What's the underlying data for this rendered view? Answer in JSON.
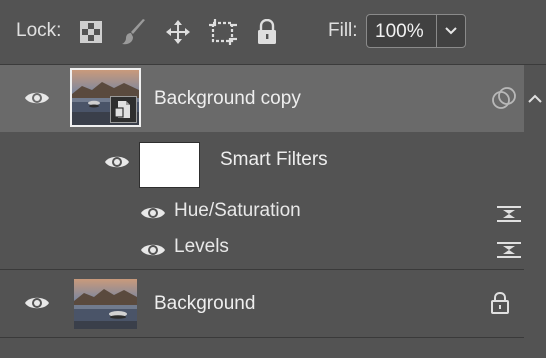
{
  "lockbar": {
    "lock_label": "Lock:",
    "icons": [
      "transparency-lock-icon",
      "brush-lock-icon",
      "move-lock-icon",
      "artboard-lock-icon",
      "padlock-icon"
    ],
    "fill_label": "Fill:",
    "fill_value": "100%"
  },
  "layers": [
    {
      "name": "Background copy",
      "selected": true,
      "smart_object": true,
      "visible": true,
      "smart_filters": {
        "label": "Smart Filters",
        "filters": [
          {
            "name": "Hue/Saturation"
          },
          {
            "name": "Levels"
          }
        ]
      }
    },
    {
      "name": "Background",
      "selected": false,
      "locked": true,
      "visible": true
    }
  ],
  "colors": {
    "panel_bg": "#535353",
    "selected_row": "#6a6a6a",
    "text": "#e6e6e6"
  }
}
